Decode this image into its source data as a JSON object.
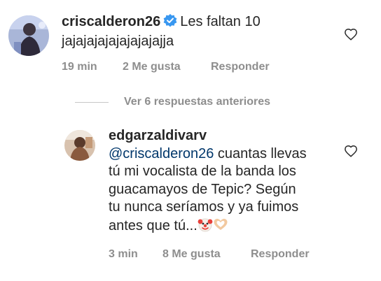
{
  "comments": [
    {
      "username": "criscalderon26",
      "verified": true,
      "text_line1": "Les faltan 10",
      "text_line2": "jajajajajajajajajajja",
      "time": "19 min",
      "likes": "2 Me gusta",
      "reply": "Responder"
    }
  ],
  "replies_toggle": "Ver 6 respuestas anteriores",
  "reply": {
    "username": "edgarzaldivarv",
    "mention": "@criscalderon26",
    "line1_rest": " cuantas llevas",
    "line2": "tú mi vocalista de la banda los",
    "line3": "guacamayos de Tepic? Según",
    "line4": "tu nunca seríamos y ya fuimos",
    "line5": "antes que tú...",
    "emojis": [
      "clown-face",
      "heart-hands"
    ],
    "time": "3 min",
    "likes": "8 Me gusta",
    "reply": "Responder"
  },
  "colors": {
    "text": "#262626",
    "secondary": "#8e8e8e",
    "mention": "#00376b",
    "verified": "#3897f0"
  }
}
